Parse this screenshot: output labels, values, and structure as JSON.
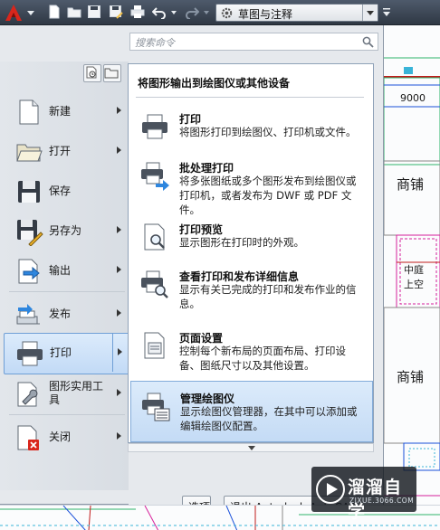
{
  "quick_access": {
    "workspace_label": "草图与注释"
  },
  "search": {
    "placeholder": "搜索命令"
  },
  "app_menu": {
    "items": [
      {
        "label": "新建",
        "icon": "new-file-icon",
        "has_submenu": true
      },
      {
        "label": "打开",
        "icon": "open-folder-icon",
        "has_submenu": true
      },
      {
        "label": "保存",
        "icon": "save-icon",
        "has_submenu": false
      },
      {
        "label": "另存为",
        "icon": "save-as-icon",
        "has_submenu": true
      },
      {
        "label": "输出",
        "icon": "export-icon",
        "has_submenu": true
      },
      {
        "label": "发布",
        "icon": "publish-icon",
        "has_submenu": true
      },
      {
        "label": "打印",
        "icon": "print-icon",
        "has_submenu": true,
        "active": true
      },
      {
        "label": "图形实用工具",
        "icon": "wrench-icon",
        "has_submenu": true
      },
      {
        "label": "关闭",
        "icon": "close-file-icon",
        "has_submenu": true
      }
    ]
  },
  "submenu": {
    "title": "将图形输出到绘图仪或其他设备",
    "items": [
      {
        "title": "打印",
        "desc": "将图形打印到绘图仪、打印机或文件。"
      },
      {
        "title": "批处理打印",
        "desc": "将多张图纸或多个图形发布到绘图仪或打印机，或者发布为 DWF 或 PDF 文件。"
      },
      {
        "title": "打印预览",
        "desc": "显示图形在打印时的外观。"
      },
      {
        "title": "查看打印和发布详细信息",
        "desc": "显示有关已完成的打印和发布作业的信息。"
      },
      {
        "title": "页面设置",
        "desc": "控制每个新布局的页面布局、打印设备、图纸尺寸以及其他设置。"
      },
      {
        "title": "管理绘图仪",
        "desc": "显示绘图仪管理器，在其中可以添加或编辑绘图仪配置。",
        "highlighted": true
      }
    ]
  },
  "footer": {
    "options_label": "选项",
    "exit_label": "退出 Autodesk AutoCAD"
  },
  "drawing": {
    "dimension": "9000",
    "room_1": "商铺",
    "room_2_line1": "中庭",
    "room_2_line2": "上空",
    "room_3": "商铺"
  },
  "watermark": {
    "name": "溜溜自学",
    "url": "ZIXUE.3066.COM"
  },
  "colors": {
    "accent": "#c2daf6",
    "menu_bg": "#e6e9ed",
    "titlebar": "#3a4452"
  }
}
